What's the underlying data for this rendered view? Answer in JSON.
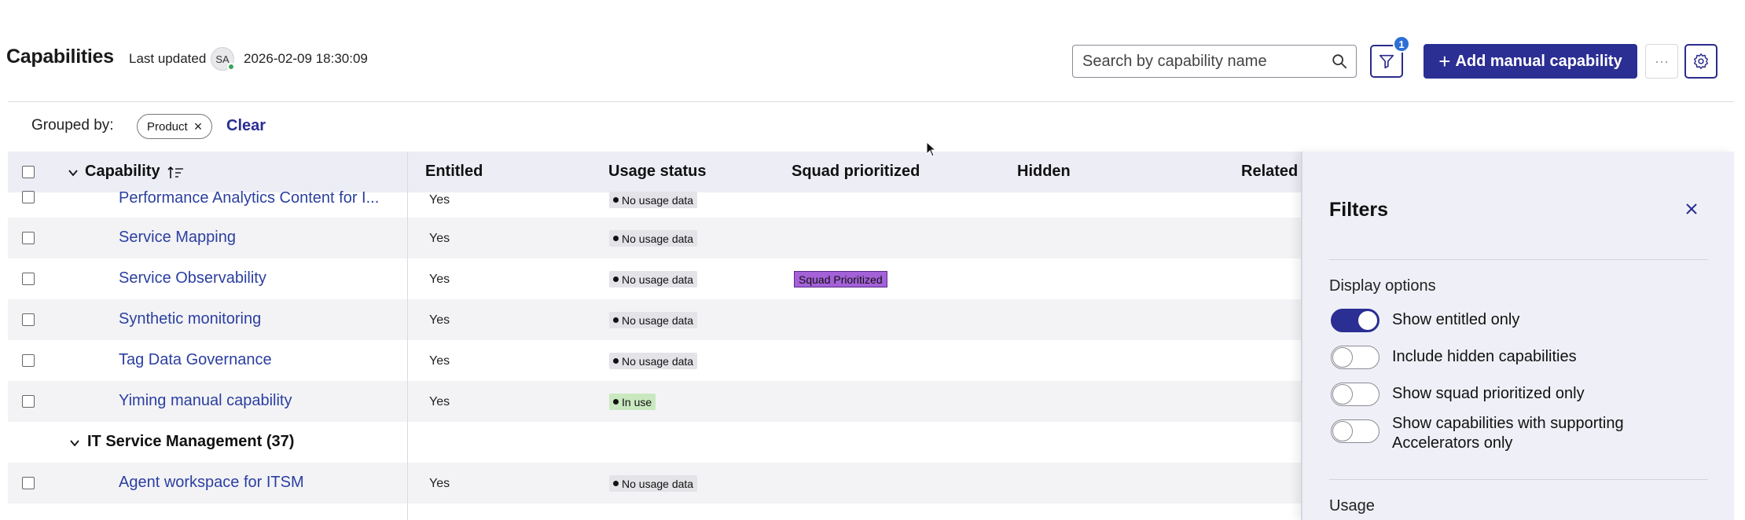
{
  "header": {
    "title": "Capabilities",
    "last_updated_label": "Last updated",
    "avatar_initials": "SA",
    "timestamp": "2026-02-09 18:30:09",
    "search_placeholder": "Search by capability name",
    "filter_count": "1",
    "add_button_label": "Add manual capability",
    "more_label": "···"
  },
  "grouping": {
    "label": "Grouped by:",
    "chip_label": "Product",
    "clear_label": "Clear"
  },
  "table": {
    "columns": [
      "Capability",
      "Entitled",
      "Usage status",
      "Squad prioritized",
      "Hidden",
      "Related A"
    ],
    "rows": [
      {
        "name": "Performance Analytics Content for I...",
        "entitled": "Yes",
        "usage": "No usage data",
        "squad": ""
      },
      {
        "name": "Service Mapping",
        "entitled": "Yes",
        "usage": "No usage data",
        "squad": ""
      },
      {
        "name": "Service Observability",
        "entitled": "Yes",
        "usage": "No usage data",
        "squad": "Squad Prioritized"
      },
      {
        "name": "Synthetic monitoring",
        "entitled": "Yes",
        "usage": "No usage data",
        "squad": ""
      },
      {
        "name": "Tag Data Governance",
        "entitled": "Yes",
        "usage": "No usage data",
        "squad": ""
      },
      {
        "name": "Yiming manual capability",
        "entitled": "Yes",
        "usage": "In use",
        "squad": ""
      }
    ],
    "group_row": "IT Service Management (37)",
    "last_row": {
      "name": "Agent workspace for ITSM",
      "entitled": "Yes",
      "usage": "No usage data"
    }
  },
  "filters_panel": {
    "title": "Filters",
    "display_options_label": "Display options",
    "toggles": [
      {
        "label": "Show entitled only",
        "on": true
      },
      {
        "label": "Include hidden capabilities",
        "on": false
      },
      {
        "label": "Show squad prioritized only",
        "on": false
      },
      {
        "label": "Show capabilities with supporting Accelerators only",
        "on": false
      }
    ],
    "usage_label": "Usage"
  },
  "colors": {
    "primary": "#2b2e93",
    "link": "#2b3fa0",
    "badge_gray": "#e4e4e8",
    "badge_green": "#c9e8c0",
    "badge_purple": "#a461d8",
    "header_bg": "#ecedf5",
    "panel_bg": "#eff0f7"
  }
}
